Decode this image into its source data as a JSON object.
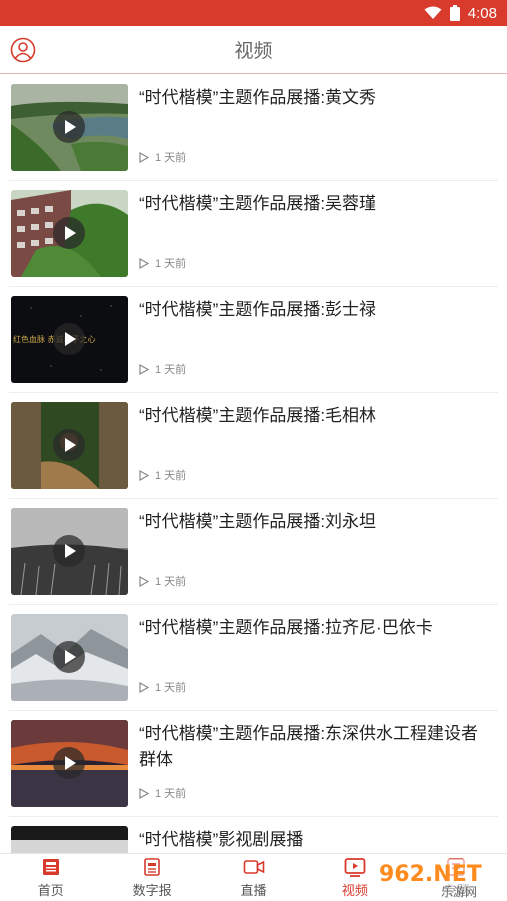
{
  "status": {
    "time": "4:08"
  },
  "header": {
    "title": "视频"
  },
  "videos": [
    {
      "title": "“时代楷模”主题作品展播:黄文秀",
      "time": "1 天前"
    },
    {
      "title": "“时代楷模”主题作品展播:吴蓉瑾",
      "time": "1 天前"
    },
    {
      "title": "“时代楷模”主题作品展播:彭士禄",
      "time": "1 天前",
      "overlay_text": "红色血脉  赤诚赤子之心"
    },
    {
      "title": "“时代楷模”主题作品展播:毛相林",
      "time": "1 天前"
    },
    {
      "title": "“时代楷模”主题作品展播:刘永坦",
      "time": "1 天前"
    },
    {
      "title": "“时代楷模”主题作品展播:拉齐尼·巴依卡",
      "time": "1 天前"
    },
    {
      "title": "“时代楷模”主题作品展播:东深供水工程建设者群体",
      "time": "1 天前"
    },
    {
      "title": "“时代楷模”影视剧展播",
      "time": ""
    }
  ],
  "tabs": [
    {
      "label": "首页",
      "icon": "newspaper-icon"
    },
    {
      "label": "数字报",
      "icon": "digital-paper-icon"
    },
    {
      "label": "直播",
      "icon": "camera-icon"
    },
    {
      "label": "视频",
      "icon": "video-play-icon",
      "active": true
    },
    {
      "label": "专题",
      "icon": "topic-icon"
    }
  ],
  "watermark": {
    "text": "962.NET",
    "subtext": "乐游网"
  },
  "colors": {
    "accent": "#d83a2c",
    "text": "#222222",
    "meta": "#888888"
  }
}
